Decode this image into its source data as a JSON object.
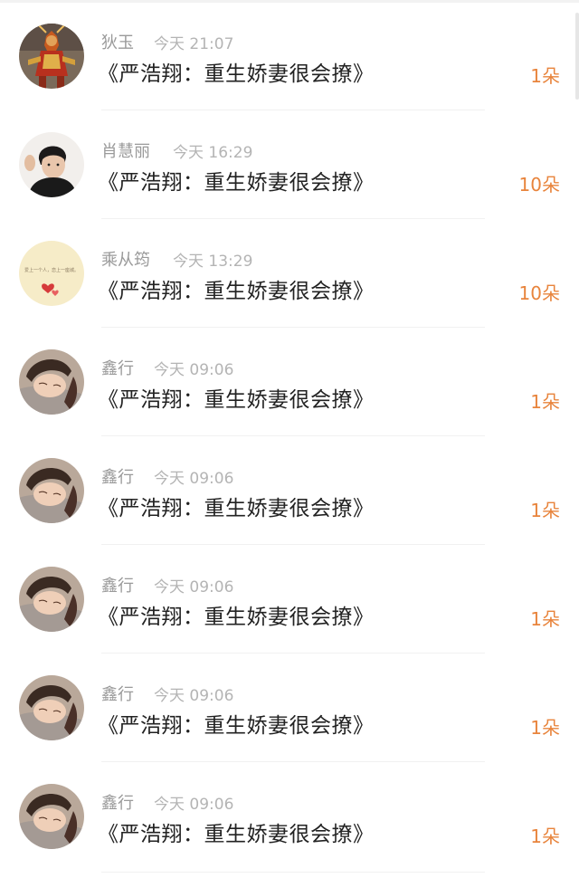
{
  "gift_list": {
    "items": [
      {
        "name": "狄玉",
        "time": "今天 21:07",
        "title": "《严浩翔：重生娇妻很会撩》",
        "amount": "1朵",
        "avatar": "monkey-king-avatar"
      },
      {
        "name": "肖慧丽",
        "time": "今天 16:29",
        "title": "《严浩翔：重生娇妻很会撩》",
        "amount": "10朵",
        "avatar": "boy-selfie-avatar"
      },
      {
        "name": "乘从筠",
        "time": "今天 13:29",
        "title": "《严浩翔：重生娇妻很会撩》",
        "amount": "10朵",
        "avatar": "text-heart-avatar"
      },
      {
        "name": "鑫行",
        "time": "今天 09:06",
        "title": "《严浩翔：重生娇妻很会撩》",
        "amount": "1朵",
        "avatar": "sleeping-boy-avatar"
      },
      {
        "name": "鑫行",
        "time": "今天 09:06",
        "title": "《严浩翔：重生娇妻很会撩》",
        "amount": "1朵",
        "avatar": "sleeping-boy-avatar"
      },
      {
        "name": "鑫行",
        "time": "今天 09:06",
        "title": "《严浩翔：重生娇妻很会撩》",
        "amount": "1朵",
        "avatar": "sleeping-boy-avatar"
      },
      {
        "name": "鑫行",
        "time": "今天 09:06",
        "title": "《严浩翔：重生娇妻很会撩》",
        "amount": "1朵",
        "avatar": "sleeping-boy-avatar"
      },
      {
        "name": "鑫行",
        "time": "今天 09:06",
        "title": "《严浩翔：重生娇妻很会撩》",
        "amount": "1朵",
        "avatar": "sleeping-boy-avatar"
      }
    ]
  },
  "avatar_text": {
    "text_heart": "爱上一个人，恋上一座城。"
  },
  "colors": {
    "accent": "#e8843c",
    "name": "#9a9a9a",
    "time": "#b4b4b4",
    "title": "#222222"
  }
}
